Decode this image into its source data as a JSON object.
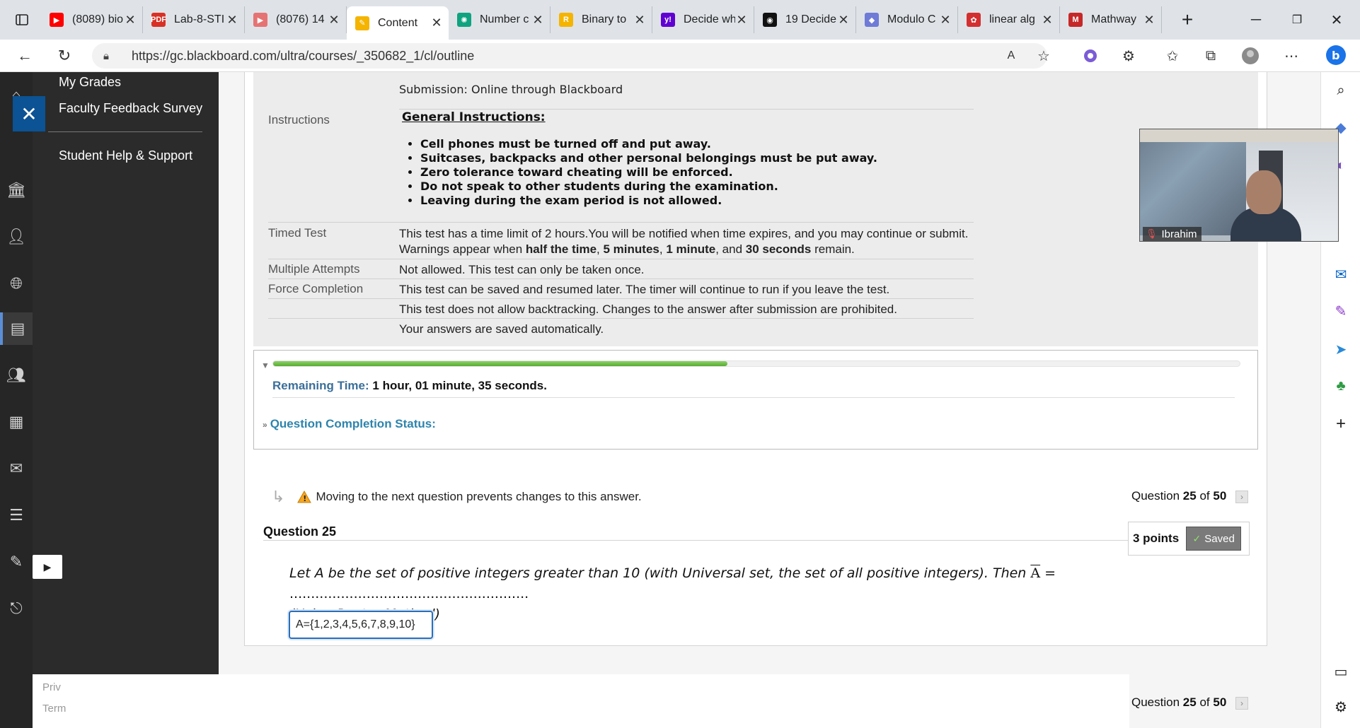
{
  "browser": {
    "tabs": [
      {
        "label": "(8089) bio",
        "favicon_color": "#ff0000",
        "favicon": "▶"
      },
      {
        "label": "Lab-8-STI",
        "favicon_color": "#d93025",
        "favicon": "PDF"
      },
      {
        "label": "(8076) 14",
        "favicon_color": "#e57373",
        "favicon": "▶"
      },
      {
        "label": "Content",
        "favicon_color": "#f4b400",
        "favicon": "✎",
        "active": true
      },
      {
        "label": "Number c",
        "favicon_color": "#10a37f",
        "favicon": "✺"
      },
      {
        "label": "Binary to",
        "favicon_color": "#f5b400",
        "favicon": "R"
      },
      {
        "label": "Decide wh",
        "favicon_color": "#6001d2",
        "favicon": "y!"
      },
      {
        "label": "19 Decide",
        "favicon_color": "#111111",
        "favicon": "◉"
      },
      {
        "label": "Modulo C",
        "favicon_color": "#6f7bd6",
        "favicon": "◆"
      },
      {
        "label": "linear alg",
        "favicon_color": "#d32f2f",
        "favicon": "✿"
      },
      {
        "label": "Mathway",
        "favicon_color": "#c62828",
        "favicon": "M"
      }
    ],
    "tab_close": "✕",
    "new_tab": "+",
    "url": "https://gc.blackboard.com/ultra/courses/_350682_1/cl/outline"
  },
  "bb_menu": {
    "links": [
      "My Grades",
      "Faculty Feedback Survey",
      "Student Help & Support"
    ],
    "footer": [
      "Priv",
      "Term"
    ]
  },
  "test_info": {
    "submission": "Submission: Online through Blackboard",
    "instructions_label": "Instructions",
    "general_title": "General Instructions:",
    "general_items": [
      "Cell phones must be turned off and put away.",
      "Suitcases, backpacks and other personal belongings must be put away.",
      "Zero tolerance toward cheating will be enforced.",
      "Do not speak to other students during the examination.",
      "Leaving during the exam period is not allowed."
    ],
    "timed_label": "Timed Test",
    "timed_line1": "This test has a time limit of 2 hours.You will be notified when time expires, and you may continue or submit.",
    "timed_line2_pre": "Warnings appear when ",
    "timed_b1": "half the time",
    "timed_sep1": ", ",
    "timed_b2": "5 minutes",
    "timed_sep2": ", ",
    "timed_b3": "1 minute",
    "timed_sep3": ", and ",
    "timed_b4": "30 seconds",
    "timed_line2_post": " remain.",
    "attempts_label": "Multiple Attempts",
    "attempts_val": "Not allowed. This test can only be taken once.",
    "force_label": "Force Completion",
    "force_val": "This test can be saved and resumed later. The timer will continue to run if you leave the test.",
    "backtrack_val": "This test does not allow backtracking. Changes to the answer after submission are prohibited.",
    "autosave_val": "Your answers are saved automatically."
  },
  "timer": {
    "progress_fraction": 0.47,
    "remaining_label": "Remaining Time:",
    "remaining_value": "1 hour, 01 minute, 35 seconds.",
    "completion_status": "Question Completion Status:"
  },
  "question": {
    "warning": "Moving to the next question prevents changes to this answer.",
    "nav_prefix": "Question",
    "number": "25",
    "nav_of": "of",
    "total": "50",
    "header": "Question 25",
    "points": "3 points",
    "saved": "Saved",
    "text_part1": "Let A be the set of positive integers greater than 10 (with Universal set, the set of all positive integers). Then",
    "a_bar": "A",
    "text_part2": "= ........................................................",
    "text_line2": "(Using Roster Method)",
    "answer": "A={1,2,3,4,5,6,7,8,9,10}"
  },
  "video": {
    "participant": "Ibrahim"
  }
}
